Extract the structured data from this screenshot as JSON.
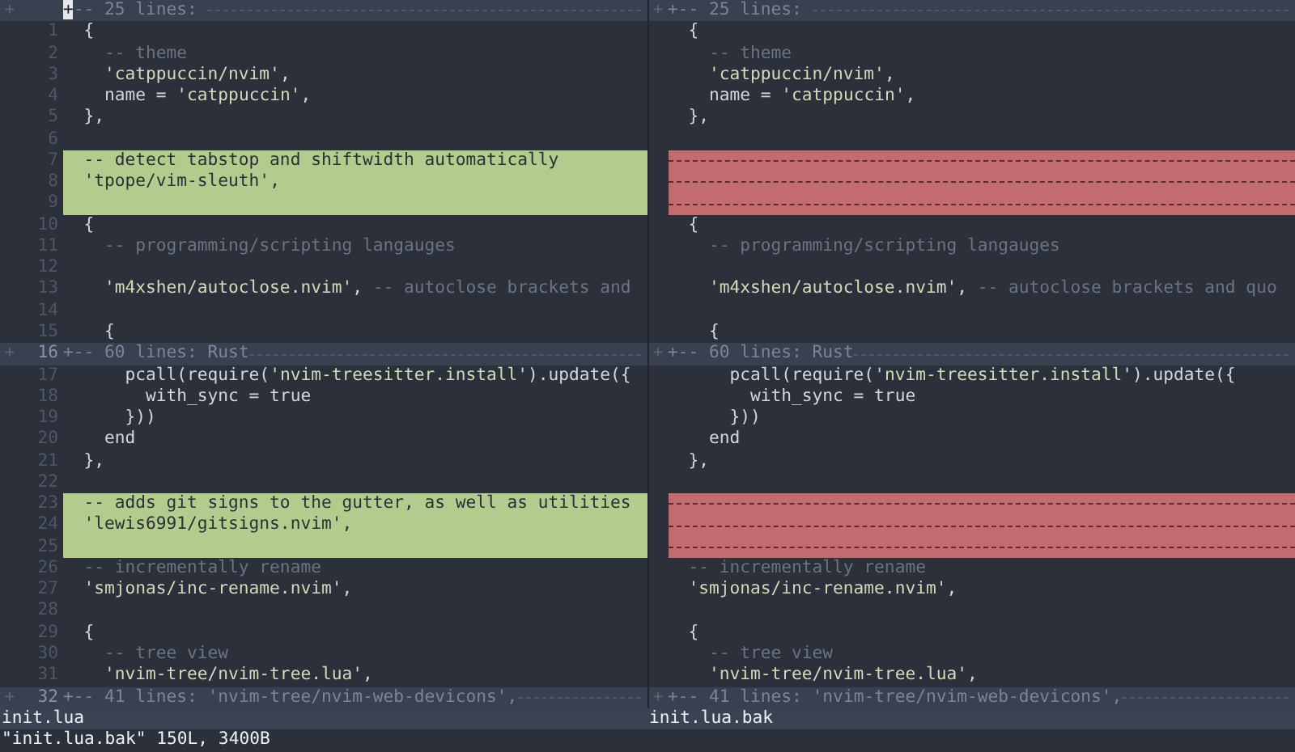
{
  "panes": [
    {
      "file_name": "init.lua",
      "lines": [
        {
          "kind": "fold",
          "sign": "+",
          "cursor": true,
          "text": "+-- 25 lines: "
        },
        {
          "kind": "code",
          "number": "1",
          "segments": [
            {
              "kind": "plain",
              "text": "  {"
            }
          ]
        },
        {
          "kind": "code",
          "number": "2",
          "segments": [
            {
              "kind": "comment",
              "text": "    -- theme"
            }
          ]
        },
        {
          "kind": "code",
          "number": "3",
          "segments": [
            {
              "kind": "string",
              "text": "    'catppuccin/nvim'"
            },
            {
              "kind": "plain",
              "text": ","
            }
          ]
        },
        {
          "kind": "code",
          "number": "4",
          "segments": [
            {
              "kind": "plain",
              "text": "    name = "
            },
            {
              "kind": "string",
              "text": "'catppuccin'"
            },
            {
              "kind": "plain",
              "text": ","
            }
          ]
        },
        {
          "kind": "code",
          "number": "5",
          "segments": [
            {
              "kind": "plain",
              "text": "  },"
            }
          ]
        },
        {
          "kind": "code",
          "number": "6"
        },
        {
          "kind": "added",
          "number": "7",
          "segments": [
            {
              "kind": "comment",
              "text": "  -- detect tabstop and shiftwidth automatically"
            }
          ]
        },
        {
          "kind": "added",
          "number": "8",
          "segments": [
            {
              "kind": "string",
              "text": "  'tpope/vim-sleuth'"
            },
            {
              "kind": "plain",
              "text": ","
            }
          ]
        },
        {
          "kind": "added",
          "number": "9"
        },
        {
          "kind": "code",
          "number": "10",
          "segments": [
            {
              "kind": "plain",
              "text": "  {"
            }
          ]
        },
        {
          "kind": "code",
          "number": "11",
          "segments": [
            {
              "kind": "comment",
              "text": "    -- programming/scripting langauges"
            }
          ]
        },
        {
          "kind": "code",
          "number": "12"
        },
        {
          "kind": "code",
          "number": "13",
          "segments": [
            {
              "kind": "string",
              "text": "    'm4xshen/autoclose.nvim'"
            },
            {
              "kind": "plain",
              "text": ", "
            },
            {
              "kind": "comment",
              "text": "-- autoclose brackets and"
            }
          ]
        },
        {
          "kind": "code",
          "number": "14"
        },
        {
          "kind": "code",
          "number": "15",
          "segments": [
            {
              "kind": "plain",
              "text": "    {"
            }
          ]
        },
        {
          "kind": "fold",
          "sign": "+",
          "number": "16",
          "cursor": false,
          "text": "+-- 60 lines: Rust"
        },
        {
          "kind": "code",
          "number": "17",
          "segments": [
            {
              "kind": "plain",
              "text": "      pcall(require("
            },
            {
              "kind": "string",
              "text": "'nvim-treesitter.install'"
            },
            {
              "kind": "plain",
              "text": ").update({"
            }
          ]
        },
        {
          "kind": "code",
          "number": "18",
          "segments": [
            {
              "kind": "plain",
              "text": "        with_sync = true"
            }
          ]
        },
        {
          "kind": "code",
          "number": "19",
          "segments": [
            {
              "kind": "plain",
              "text": "      }))"
            }
          ]
        },
        {
          "kind": "code",
          "number": "20",
          "segments": [
            {
              "kind": "plain",
              "text": "    end"
            }
          ]
        },
        {
          "kind": "code",
          "number": "21",
          "segments": [
            {
              "kind": "plain",
              "text": "  },"
            }
          ]
        },
        {
          "kind": "code",
          "number": "22"
        },
        {
          "kind": "added",
          "number": "23",
          "segments": [
            {
              "kind": "comment",
              "text": "  -- adds git signs to the gutter, as well as utilities"
            }
          ]
        },
        {
          "kind": "added",
          "number": "24",
          "segments": [
            {
              "kind": "string",
              "text": "  'lewis6991/gitsigns.nvim'"
            },
            {
              "kind": "plain",
              "text": ","
            }
          ]
        },
        {
          "kind": "added",
          "number": "25"
        },
        {
          "kind": "code",
          "number": "26",
          "segments": [
            {
              "kind": "comment",
              "text": "  -- incrementally rename"
            }
          ]
        },
        {
          "kind": "code",
          "number": "27",
          "segments": [
            {
              "kind": "string",
              "text": "  'smjonas/inc-rename.nvim'"
            },
            {
              "kind": "plain",
              "text": ","
            }
          ]
        },
        {
          "kind": "code",
          "number": "28"
        },
        {
          "kind": "code",
          "number": "29",
          "segments": [
            {
              "kind": "plain",
              "text": "  {"
            }
          ]
        },
        {
          "kind": "code",
          "number": "30",
          "segments": [
            {
              "kind": "comment",
              "text": "    -- tree view"
            }
          ]
        },
        {
          "kind": "code",
          "number": "31",
          "segments": [
            {
              "kind": "string",
              "text": "    'nvim-tree/nvim-tree.lua'"
            },
            {
              "kind": "plain",
              "text": ","
            }
          ]
        },
        {
          "kind": "fold",
          "sign": "+",
          "number": "32",
          "cursor": false,
          "text": "+-- 41 lines: 'nvim-tree/nvim-web-devicons',"
        }
      ]
    },
    {
      "file_name": "init.lua.bak",
      "lines": [
        {
          "kind": "fold",
          "sign": "+",
          "cursor": false,
          "text": "+-- 25 lines: "
        },
        {
          "kind": "code",
          "segments": [
            {
              "kind": "plain",
              "text": "  {"
            }
          ]
        },
        {
          "kind": "code",
          "segments": [
            {
              "kind": "comment",
              "text": "    -- theme"
            }
          ]
        },
        {
          "kind": "code",
          "segments": [
            {
              "kind": "string",
              "text": "    'catppuccin/nvim'"
            },
            {
              "kind": "plain",
              "text": ","
            }
          ]
        },
        {
          "kind": "code",
          "segments": [
            {
              "kind": "plain",
              "text": "    name = "
            },
            {
              "kind": "string",
              "text": "'catppuccin'"
            },
            {
              "kind": "plain",
              "text": ","
            }
          ]
        },
        {
          "kind": "code",
          "segments": [
            {
              "kind": "plain",
              "text": "  },"
            }
          ]
        },
        {
          "kind": "code"
        },
        {
          "kind": "filler"
        },
        {
          "kind": "filler"
        },
        {
          "kind": "filler"
        },
        {
          "kind": "code",
          "segments": [
            {
              "kind": "plain",
              "text": "  {"
            }
          ]
        },
        {
          "kind": "code",
          "segments": [
            {
              "kind": "comment",
              "text": "    -- programming/scripting langauges"
            }
          ]
        },
        {
          "kind": "code"
        },
        {
          "kind": "code",
          "segments": [
            {
              "kind": "string",
              "text": "    'm4xshen/autoclose.nvim'"
            },
            {
              "kind": "plain",
              "text": ", "
            },
            {
              "kind": "comment",
              "text": "-- autoclose brackets and quo"
            }
          ]
        },
        {
          "kind": "code"
        },
        {
          "kind": "code",
          "segments": [
            {
              "kind": "plain",
              "text": "    {"
            }
          ]
        },
        {
          "kind": "fold",
          "sign": "+",
          "cursor": false,
          "text": "+-- 60 lines: Rust"
        },
        {
          "kind": "code",
          "segments": [
            {
              "kind": "plain",
              "text": "      pcall(require("
            },
            {
              "kind": "string",
              "text": "'nvim-treesitter.install'"
            },
            {
              "kind": "plain",
              "text": ").update({"
            }
          ]
        },
        {
          "kind": "code",
          "segments": [
            {
              "kind": "plain",
              "text": "        with_sync = true"
            }
          ]
        },
        {
          "kind": "code",
          "segments": [
            {
              "kind": "plain",
              "text": "      }))"
            }
          ]
        },
        {
          "kind": "code",
          "segments": [
            {
              "kind": "plain",
              "text": "    end"
            }
          ]
        },
        {
          "kind": "code",
          "segments": [
            {
              "kind": "plain",
              "text": "  },"
            }
          ]
        },
        {
          "kind": "code"
        },
        {
          "kind": "filler"
        },
        {
          "kind": "filler"
        },
        {
          "kind": "filler"
        },
        {
          "kind": "code",
          "segments": [
            {
              "kind": "comment",
              "text": "  -- incrementally rename"
            }
          ]
        },
        {
          "kind": "code",
          "segments": [
            {
              "kind": "string",
              "text": "  'smjonas/inc-rename.nvim'"
            },
            {
              "kind": "plain",
              "text": ","
            }
          ]
        },
        {
          "kind": "code"
        },
        {
          "kind": "code",
          "segments": [
            {
              "kind": "plain",
              "text": "  {"
            }
          ]
        },
        {
          "kind": "code",
          "segments": [
            {
              "kind": "comment",
              "text": "    -- tree view"
            }
          ]
        },
        {
          "kind": "code",
          "segments": [
            {
              "kind": "string",
              "text": "    'nvim-tree/nvim-tree.lua'"
            },
            {
              "kind": "plain",
              "text": ","
            }
          ]
        },
        {
          "kind": "fold",
          "sign": "+",
          "cursor": false,
          "text": "+-- 41 lines: 'nvim-tree/nvim-web-devicons',"
        }
      ]
    }
  ],
  "command_line": "\"init.lua.bak\" 150L, 3400B"
}
